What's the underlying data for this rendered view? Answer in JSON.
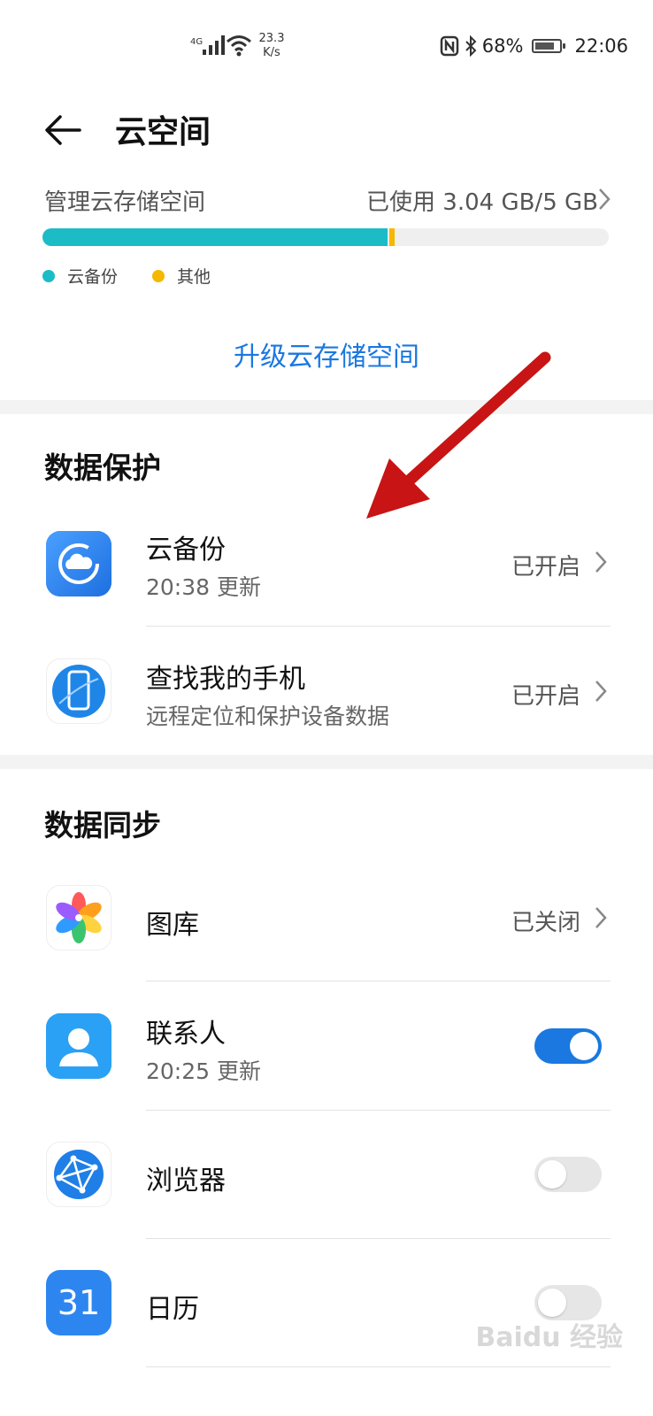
{
  "status_bar": {
    "network": "4G",
    "speed_value": "23.3",
    "speed_unit": "K/s",
    "battery": "68%",
    "time": "22:06"
  },
  "header": {
    "title": "云空间"
  },
  "storage": {
    "label": "管理云存储空间",
    "used_text": "已使用 3.04 GB/5 GB",
    "backup_fraction": 0.61,
    "other_fraction": 0.009,
    "legend": [
      {
        "label": "云备份",
        "color": "#1cbcc6"
      },
      {
        "label": "其他",
        "color": "#f5b800"
      }
    ],
    "upgrade": "升级云存储空间"
  },
  "protection": {
    "title": "数据保护",
    "items": [
      {
        "title": "云备份",
        "subtitle": "20:38 更新",
        "state": "已开启",
        "icon": "cloud-backup-icon"
      },
      {
        "title": "查找我的手机",
        "subtitle": "远程定位和保护设备数据",
        "state": "已开启",
        "icon": "find-phone-icon"
      }
    ]
  },
  "sync": {
    "title": "数据同步",
    "items": [
      {
        "title": "图库",
        "state": "已关闭",
        "icon": "gallery-icon"
      },
      {
        "title": "联系人",
        "subtitle": "20:25 更新",
        "enabled": true,
        "icon": "contacts-icon"
      },
      {
        "title": "浏览器",
        "enabled": false,
        "icon": "browser-icon"
      },
      {
        "title": "日历",
        "enabled": false,
        "icon": "calendar-icon",
        "icon_text": "31"
      }
    ]
  },
  "colors": {
    "accent": "#1a78e0",
    "toggle_on": "#1a78e0",
    "toggle_off": "#e6e6e6"
  },
  "watermark": "Baidu 经验"
}
